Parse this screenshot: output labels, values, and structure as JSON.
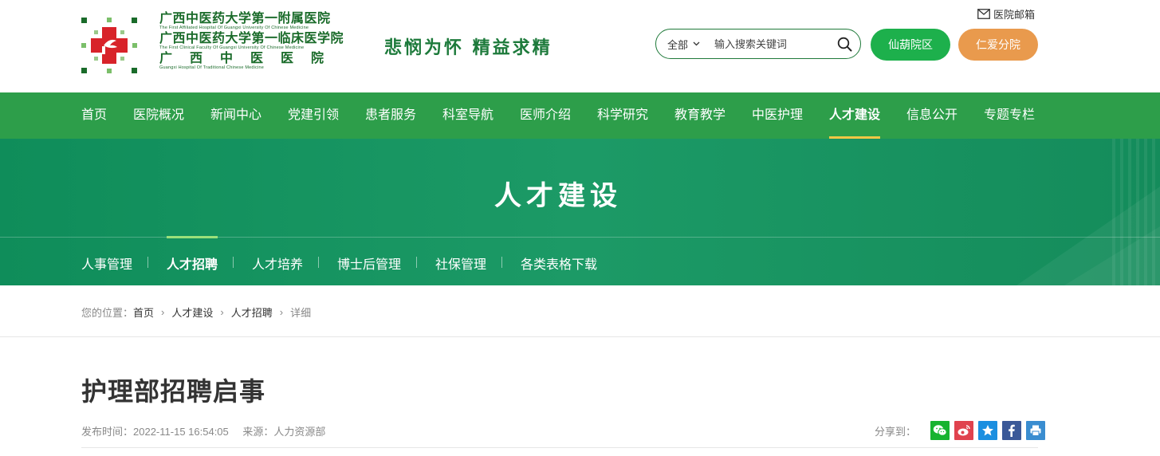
{
  "header": {
    "logo_line1": "广西中医药大学第一附属医院",
    "logo_line1_en": "The First Affiliated Hospital Of Guangxi University Of Chinese Medicine",
    "logo_line2": "广西中医药大学第一临床医学院",
    "logo_line2_en": "The First Clinical Faculty Of Guangxi University Of Chinese Medicine",
    "logo_line3": "广西中医医院",
    "logo_line3_en": "Guangxi Hospital Of Traditional Chinese Medicine",
    "motto": "悲悯为怀 精益求精",
    "mailbox_label": "医院邮箱",
    "search": {
      "scope": "全部",
      "placeholder": "输入搜索关键词"
    },
    "campus_a": "仙葫院区",
    "campus_b": "仁爱分院",
    "colors": {
      "primary_green": "#2d9e4a",
      "campus_a": "#1db04c",
      "campus_b": "#e99a4d"
    }
  },
  "nav": {
    "items": [
      "首页",
      "医院概况",
      "新闻中心",
      "党建引领",
      "患者服务",
      "科室导航",
      "医师介绍",
      "科学研究",
      "教育教学",
      "中医护理",
      "人才建设",
      "信息公开",
      "专题专栏"
    ],
    "active": "人才建设"
  },
  "banner": {
    "title": "人才建设"
  },
  "subnav": {
    "items": [
      "人事管理",
      "人才招聘",
      "人才培养",
      "博士后管理",
      "社保管理",
      "各类表格下载"
    ],
    "active": "人才招聘"
  },
  "breadcrumb": {
    "label": "您的位置：",
    "items": [
      "首页",
      "人才建设",
      "人才招聘",
      "详细"
    ]
  },
  "article": {
    "title": "护理部招聘启事",
    "publish_label": "发布时间：",
    "publish_time": "2022-11-15 16:54:05",
    "source_label": "来源：",
    "source": "人力资源部"
  },
  "share": {
    "label": "分享到：",
    "icons": [
      "wechat-icon",
      "weibo-icon",
      "qzone-icon",
      "facebook-icon",
      "print-icon"
    ]
  }
}
